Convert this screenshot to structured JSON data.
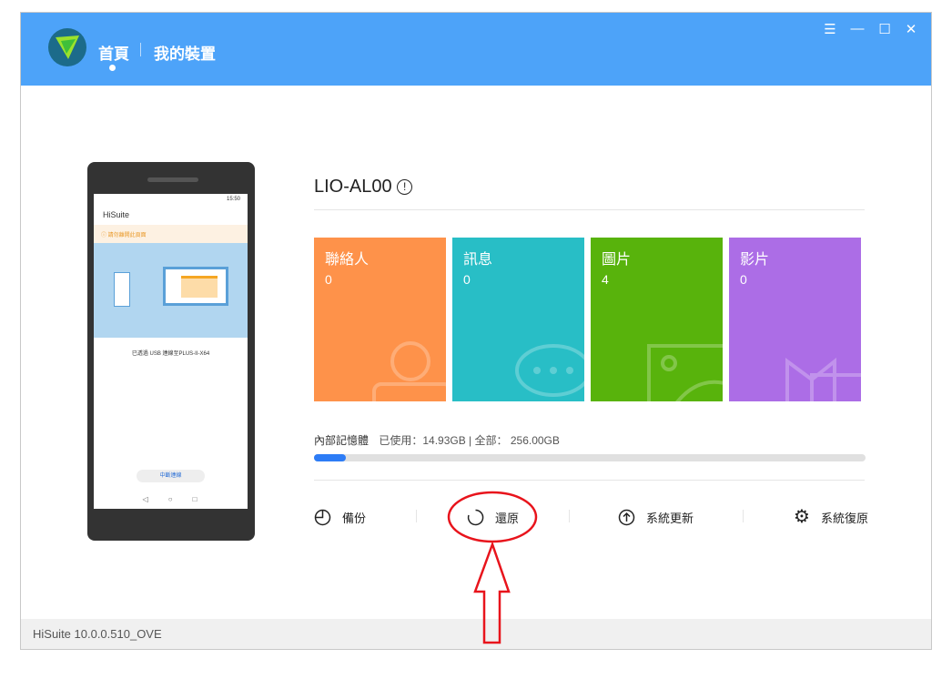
{
  "header": {
    "nav": [
      {
        "label": "首頁",
        "active": true
      },
      {
        "label": "我的裝置",
        "active": false
      }
    ]
  },
  "phone": {
    "time": "15:50",
    "app_title": "HiSuite",
    "warning": "請勿離開此頁面",
    "connection": "已透過 USB 連線至PLUS-II-X64",
    "disconnect": "中斷連線"
  },
  "device": {
    "name": "LIO-AL00"
  },
  "tiles": [
    {
      "label": "聯絡人",
      "count": "0",
      "color": "#fe924a"
    },
    {
      "label": "訊息",
      "count": "0",
      "color": "#28bec6"
    },
    {
      "label": "圖片",
      "count": "4",
      "color": "#58b30c"
    },
    {
      "label": "影片",
      "count": "0",
      "color": "#ac6de6"
    }
  ],
  "storage": {
    "label": "內部記憶體",
    "used": "已使用：14.93GB | 全部： 256.00GB",
    "used_fraction": 0.058
  },
  "actions": [
    {
      "label": "備份"
    },
    {
      "label": "還原"
    },
    {
      "label": "系統更新"
    },
    {
      "label": "系統復原"
    }
  ],
  "footer": {
    "version": "HiSuite 10.0.0.510_OVE"
  }
}
